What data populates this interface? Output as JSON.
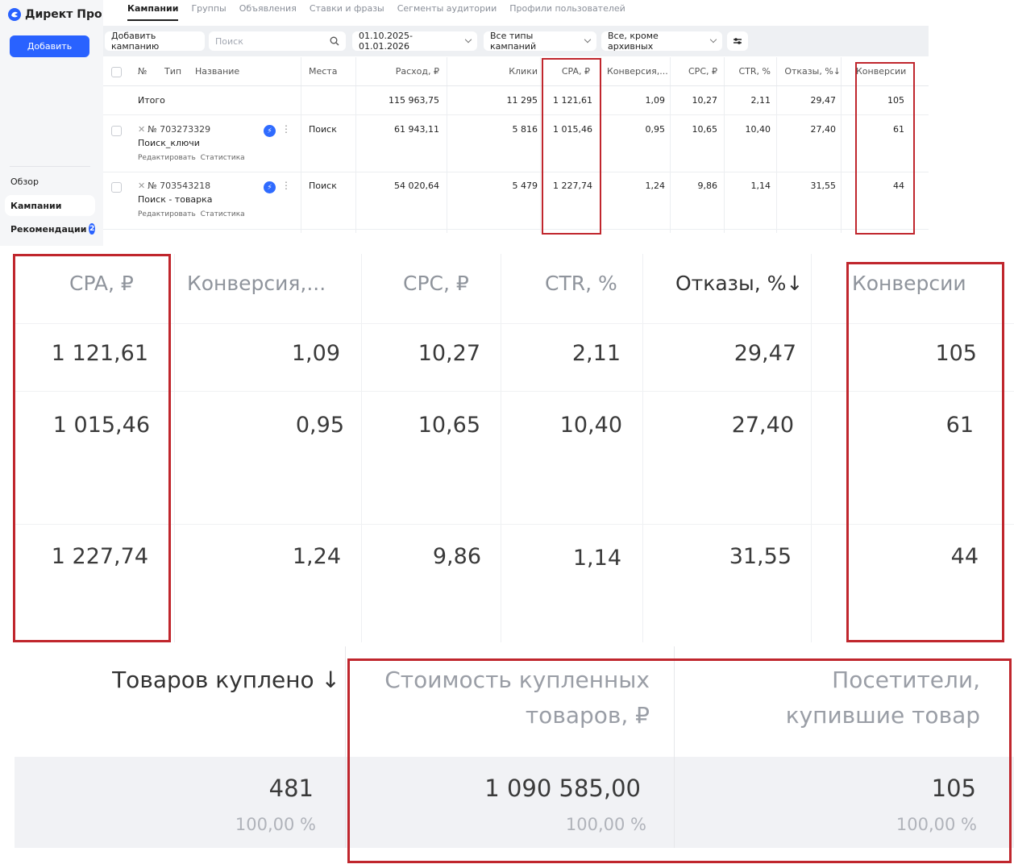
{
  "app": {
    "logo_text": "Директ Про",
    "add_button": "Добавить"
  },
  "sidebar": {
    "items": [
      {
        "label": "Обзор"
      },
      {
        "label": "Кампании"
      },
      {
        "label": "Рекомендации",
        "badge": "2"
      }
    ]
  },
  "tabs": [
    {
      "label": "Кампании",
      "active": true
    },
    {
      "label": "Группы"
    },
    {
      "label": "Объявления"
    },
    {
      "label": "Ставки и фразы"
    },
    {
      "label": "Сегменты аудитории"
    },
    {
      "label": "Профили пользователей"
    }
  ],
  "toolbar": {
    "add_campaign": "Добавить кампанию",
    "search_placeholder": "Поиск",
    "date_range": "01.10.2025-01.01.2026",
    "campaign_types": "Все типы кампаний",
    "archive_filter": "Все, кроме архивных"
  },
  "table": {
    "headers": {
      "num": "№",
      "type": "Тип",
      "name": "Название",
      "places": "Места",
      "cost": "Расход, ₽",
      "clicks": "Клики",
      "cpa": "CPA, ₽",
      "conv_rate": "Конверсия,...",
      "cpc": "CPC, ₽",
      "ctr": "CTR, %",
      "bounce": "Отказы, %↓",
      "conversions": "Конверсии"
    },
    "total": {
      "label": "Итого",
      "cost": "115 963,75",
      "clicks": "11 295",
      "cpa": "1 121,61",
      "conv_rate": "1,09",
      "cpc": "10,27",
      "ctr": "2,11",
      "bounce": "29,47",
      "conversions": "105"
    },
    "rows": [
      {
        "num": "№ 703273329",
        "name": "Поиск_ключи",
        "edit": "Редактировать",
        "stats": "Статистика",
        "places": "Поиск",
        "cost": "61 943,11",
        "clicks": "5 816",
        "cpa": "1 015,46",
        "conv_rate": "0,95",
        "cpc": "10,65",
        "ctr": "10,40",
        "bounce": "27,40",
        "conversions": "61"
      },
      {
        "num": "№ 703543218",
        "name": "Поиск - товарка",
        "edit": "Редактировать",
        "stats": "Статистика",
        "places": "Поиск",
        "cost": "54 020,64",
        "clicks": "5 479",
        "cpa": "1 227,74",
        "conv_rate": "1,24",
        "cpc": "9,86",
        "ctr": "1,14",
        "bounce": "31,55",
        "conversions": "44"
      }
    ]
  },
  "zoom": {
    "headers": {
      "cpa": "CPA, ₽",
      "conv_rate": "Конверсия,...",
      "cpc": "CPC, ₽",
      "ctr": "CTR, %",
      "bounce": "Отказы, %↓",
      "conversions": "Конверсии"
    },
    "rows": [
      {
        "cpa": "1 121,61",
        "conv_rate": "1,09",
        "cpc": "10,27",
        "ctr": "2,11",
        "bounce": "29,47",
        "conversions": "105"
      },
      {
        "cpa": "1 015,46",
        "conv_rate": "0,95",
        "cpc": "10,65",
        "ctr": "10,40",
        "bounce": "27,40",
        "conversions": "61"
      },
      {
        "cpa": "1 227,74",
        "conv_rate": "1,24",
        "cpc": "9,86",
        "ctr": "1,14",
        "bounce": "31,55",
        "conversions": "44"
      }
    ]
  },
  "purchases": {
    "items_bought": {
      "header": "Товаров куплено ↓",
      "value": "481",
      "pct": "100,00 %"
    },
    "purchase_value": {
      "header_line1": "Стоимость купленных",
      "header_line2": "товаров, ₽",
      "value": "1 090 585,00",
      "pct": "100,00 %"
    },
    "buyers": {
      "header_line1": "Посетители,",
      "header_line2": "купившие товар",
      "value": "105",
      "pct": "100,00 %"
    }
  },
  "colors": {
    "accent": "#2962ff",
    "highlight": "#c0262d"
  }
}
